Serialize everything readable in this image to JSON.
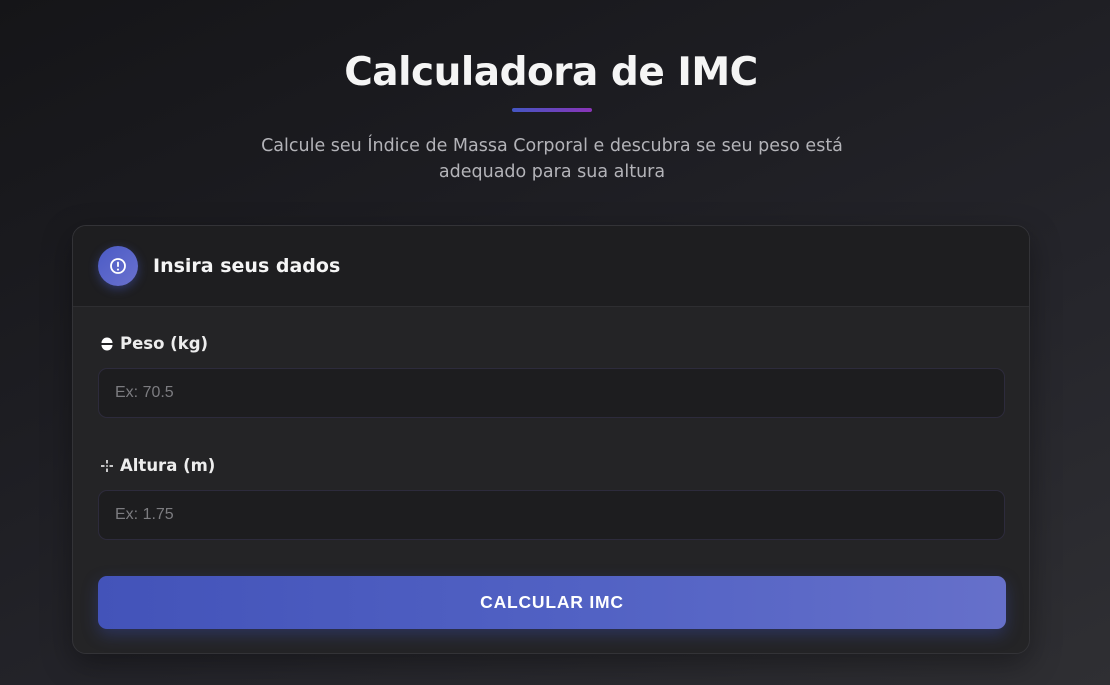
{
  "header": {
    "title": "Calculadora de IMC",
    "subtitle": "Calcule seu Índice de Massa Corporal e descubra se seu peso está adequado para sua altura"
  },
  "form": {
    "title": "Insira seus dados",
    "header_icon": "alert-circle-icon",
    "weight": {
      "label": "Peso (kg)",
      "icon": "weight-icon",
      "placeholder": "Ex: 70.5",
      "value": ""
    },
    "height": {
      "label": "Altura (m)",
      "icon": "height-arrows-icon",
      "placeholder": "Ex: 1.75",
      "value": ""
    },
    "submit_label": "CALCULAR IMC"
  },
  "colors": {
    "accent_start": "#4353b9",
    "accent_end": "#6670ca",
    "underline_end": "#8a34b8",
    "background": "#1d1d22",
    "card": "#242426"
  }
}
